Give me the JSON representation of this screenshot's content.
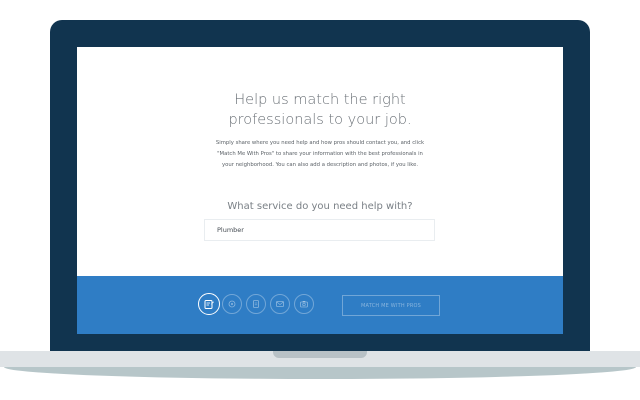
{
  "heading": {
    "line1": "Help us match the right",
    "line2": "professionals to your job."
  },
  "intro": {
    "line1": "Simply share where you need help and how pros should contact you, and click",
    "line2": "\"Match Me With Pros\" to share your information with the best professionals in",
    "line3": "your neighborhood. You can also add a description and photos, if you like."
  },
  "service": {
    "question": "What service do you need help with?",
    "value": "Plumber"
  },
  "footer": {
    "steps": [
      {
        "icon": "edit-note-icon",
        "active": true
      },
      {
        "icon": "location-pin-icon",
        "active": false
      },
      {
        "icon": "clipboard-icon",
        "active": false
      },
      {
        "icon": "envelope-icon",
        "active": false
      },
      {
        "icon": "camera-icon",
        "active": false
      }
    ],
    "match_button_label": "Match Me With Pros"
  },
  "colors": {
    "bezel": "#11344f",
    "footer_bar": "#2f7dc5",
    "base": "#dfe3e6",
    "base_shadow": "#b7c6c9"
  }
}
